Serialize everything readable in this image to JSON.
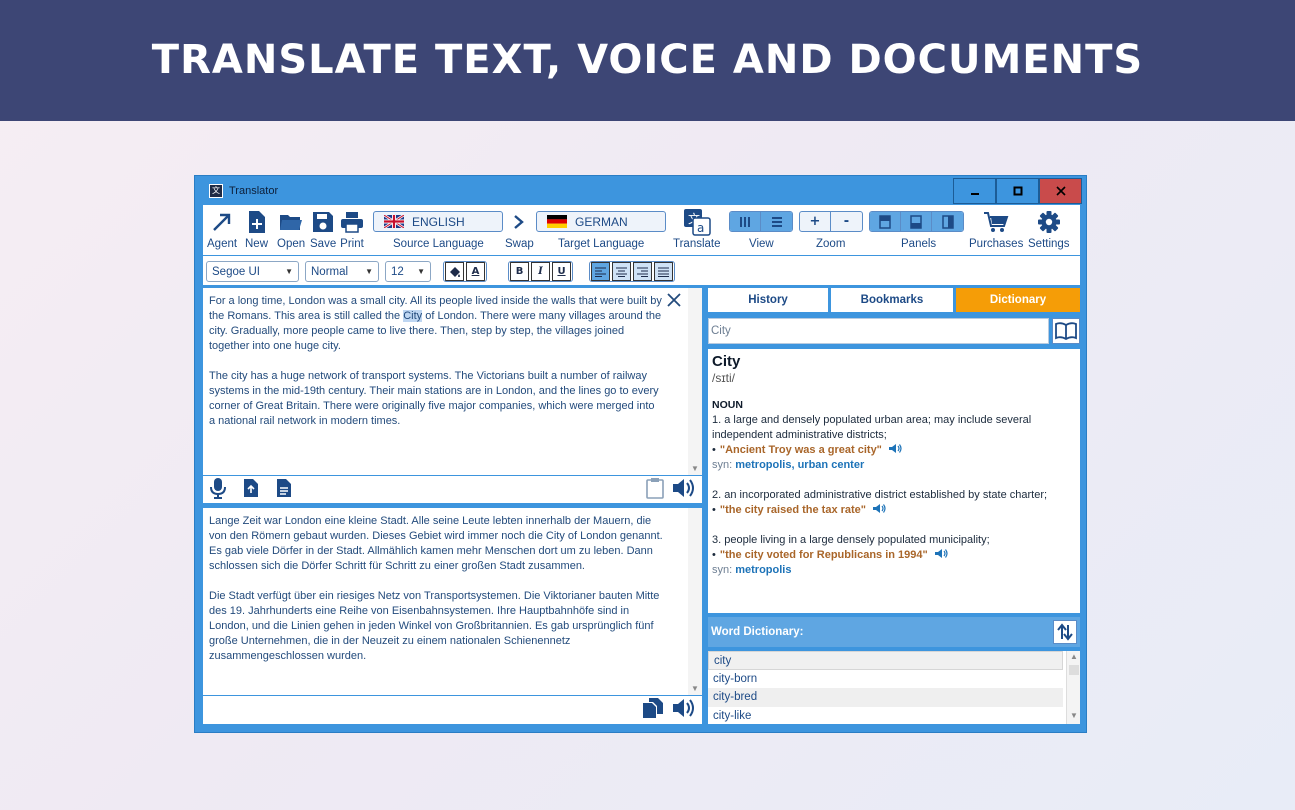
{
  "banner": {
    "headline": "TRANSLATE TEXT, VOICE AND DOCUMENTS"
  },
  "window": {
    "title": "Translator",
    "controls": {
      "minimize": "‒",
      "maximize": "▫",
      "close": "✕"
    }
  },
  "toolbar": {
    "agent": "Agent",
    "new": "New",
    "open": "Open",
    "save": "Save",
    "print": "Print",
    "source_language": "ENGLISH",
    "source_label": "Source Language",
    "swap": "Swap",
    "target_language": "GERMAN",
    "target_label": "Target Language",
    "translate": "Translate",
    "view": "View",
    "zoom": "Zoom",
    "zoom_in": "+",
    "zoom_out": "-",
    "panels": "Panels",
    "purchases": "Purchases",
    "settings": "Settings"
  },
  "format": {
    "font": "Segoe UI",
    "style": "Normal",
    "size": "12",
    "bold": "B",
    "italic": "I",
    "underline": "U",
    "font_color_glyph": "A"
  },
  "source_text": {
    "p1_before": "For a long time, London was a small city. All its people lived inside the walls that were built by the Romans. This area is still called the ",
    "p1_highlight": "City",
    "p1_after": " of London. There were many villages around the city. Gradually, more people came to live there. Then, step by step, the villages joined together into one huge city.",
    "p2": "The city has a huge network of transport systems. The Victorians built a number of railway systems in the mid-19th century. Their main stations are in London, and the lines go to every corner of Great Britain. There were originally five major companies, which were merged into a national rail network in modern times."
  },
  "target_text": {
    "p1": "Lange Zeit war London eine kleine Stadt. Alle seine Leute lebten innerhalb der Mauern, die von den Römern gebaut wurden. Dieses Gebiet wird immer noch die City of London genannt. Es gab viele Dörfer in der Stadt. Allmählich kamen mehr Menschen dort um zu leben. Dann schlossen sich die Dörfer Schritt für Schritt zu einer großen Stadt zusammen.",
    "p2": "Die Stadt verfügt über ein riesiges Netz von Transportsystemen. Die Viktorianer bauten Mitte des 19. Jahrhunderts eine Reihe von Eisenbahnsystemen. Ihre Hauptbahnhöfe sind in London, und die Linien gehen in jeden Winkel von Großbritannien. Es gab ursprünglich fünf große Unternehmen, die in der Neuzeit zu einem nationalen Schienennetz zusammengeschlossen wurden."
  },
  "side_tabs": {
    "history": "History",
    "bookmarks": "Bookmarks",
    "dictionary": "Dictionary"
  },
  "search": {
    "value": "City"
  },
  "dictionary": {
    "word": "City",
    "ipa": "/sɪti/",
    "pos": "NOUN",
    "senses": [
      {
        "def": "1. a large and densely populated urban area; may include several independent administrative districts;",
        "example": "\"Ancient Troy was a great city\"",
        "syn_label": "syn:",
        "syn": "metropolis, urban center"
      },
      {
        "def": "2. an incorporated administrative district established by state charter;",
        "example": "\"the city raised the tax rate\"",
        "syn_label": "",
        "syn": ""
      },
      {
        "def": "3. people living in a large densely populated municipality;",
        "example": "\"the city voted for Republicans in 1994\"",
        "syn_label": "syn:",
        "syn": "metropolis"
      }
    ]
  },
  "word_dictionary": {
    "title": "Word Dictionary:",
    "items": [
      "city",
      "city-born",
      "city-bred",
      "city-like"
    ]
  },
  "colors": {
    "accent": "#3d95de",
    "banner": "#3d4675",
    "active_tab": "#f59d07",
    "text": "#1d4a86"
  }
}
